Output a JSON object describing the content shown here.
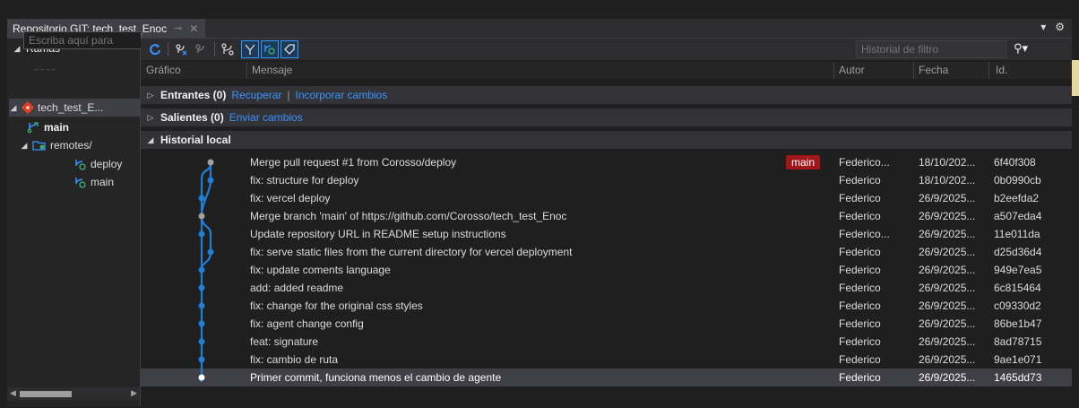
{
  "window": {
    "tab_title": "Repositorio GIT: tech_test_Enoc",
    "pin_icon": "⊸",
    "close_icon": "✕",
    "menu_icon": "▾",
    "gear_icon": "⚙"
  },
  "branches": {
    "header": "Ramas",
    "search_placeholder": "Escriba aquí para",
    "tree": [
      {
        "label": "tech_test_E...",
        "level": 1,
        "icon": "git-repo-icon"
      },
      {
        "label": "main",
        "level": 2,
        "icon": "branch-icon",
        "bold": true
      },
      {
        "label": "remotes/",
        "level": 2,
        "icon": "remote-folder-icon"
      },
      {
        "label": "deploy",
        "level": 3,
        "icon": "remote-branch-icon"
      },
      {
        "label": "main",
        "level": 3,
        "icon": "remote-branch-icon"
      }
    ]
  },
  "toolbar": {
    "filter_placeholder": "Historial de filtro",
    "buttons": [
      "refresh-icon",
      "fetch-icon",
      "pull-icon",
      "branch-graph-icon",
      "first-parent-icon",
      "remote-branches-icon",
      "tag-icon"
    ]
  },
  "columns": {
    "graph": "Gráfico",
    "message": "Mensaje",
    "author": "Autor",
    "date": "Fecha",
    "id": "Id."
  },
  "sections": {
    "incoming": {
      "label": "Entrantes (0)",
      "link1": "Recuperar",
      "sep": "|",
      "link2": "Incorporar cambios"
    },
    "outgoing": {
      "label": "Salientes (0)",
      "link1": "Enviar cambios"
    },
    "local": {
      "label": "Historial local"
    }
  },
  "commits": [
    {
      "message": "Merge pull request #1 from Corosso/deploy",
      "author": "Federico...",
      "date": "18/10/202...",
      "id": "6f40f308",
      "tag": "main"
    },
    {
      "message": "fix: structure for deploy",
      "author": "Federico",
      "date": "18/10/202...",
      "id": "0b0990cb"
    },
    {
      "message": "fix: vercel deploy",
      "author": "Federico",
      "date": "26/9/2025...",
      "id": "b2eefda2"
    },
    {
      "message": "Merge branch 'main' of https://github.com/Corosso/tech_test_Enoc",
      "author": "Federico",
      "date": "26/9/2025...",
      "id": "a507eda4"
    },
    {
      "message": "Update repository URL in README setup instructions",
      "author": "Federico...",
      "date": "26/9/2025...",
      "id": "11e011da"
    },
    {
      "message": "fix: serve static files from the current directory for vercel deployment",
      "author": "Federico",
      "date": "26/9/2025...",
      "id": "d25d36d4"
    },
    {
      "message": "fix: update coments language",
      "author": "Federico",
      "date": "26/9/2025...",
      "id": "949e7ea5"
    },
    {
      "message": "add: added readme",
      "author": "Federico",
      "date": "26/9/2025...",
      "id": "6c815464"
    },
    {
      "message": "fix: change for the original css styles",
      "author": "Federico",
      "date": "26/9/2025...",
      "id": "c09330d2"
    },
    {
      "message": "fix: agent change config",
      "author": "Federico",
      "date": "26/9/2025...",
      "id": "86be1b47"
    },
    {
      "message": "feat: signature",
      "author": "Federico",
      "date": "26/9/2025...",
      "id": "8ad78715"
    },
    {
      "message": "fix: cambio de ruta",
      "author": "Federico",
      "date": "26/9/2025...",
      "id": "9ae1e071"
    },
    {
      "message": "Primer commit, funciona menos el cambio de agente",
      "author": "Federico",
      "date": "26/9/2025...",
      "id": "1465dd73"
    }
  ],
  "colors": {
    "accent": "#3794ff",
    "graph": "#1f7fd6",
    "merge_dot": "#a0a0a0",
    "tag_bg": "#a0161a"
  }
}
